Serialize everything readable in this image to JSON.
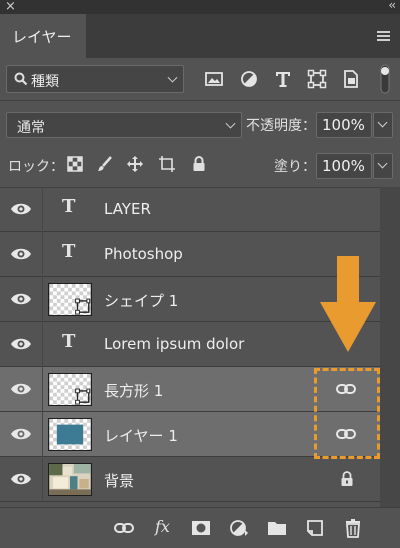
{
  "window": {
    "close_glyph": "×",
    "collapse_glyph": "‹‹"
  },
  "panel": {
    "tab_label": "レイヤー"
  },
  "filter": {
    "kind_label": "種類",
    "icons": [
      "pixel-filter-icon",
      "adjustment-filter-icon",
      "type-filter-icon",
      "shape-filter-icon",
      "smart-object-filter-icon"
    ]
  },
  "blend": {
    "mode": "通常",
    "opacity_label": "不透明度：",
    "opacity_value": "100%"
  },
  "lock": {
    "label": "ロック：",
    "fill_label": "塗り：",
    "fill_value": "100%"
  },
  "layers": [
    {
      "name": "LAYER",
      "kind": "text",
      "visible": true,
      "selected": false
    },
    {
      "name": "Photoshop",
      "kind": "text",
      "visible": true,
      "selected": false
    },
    {
      "name": "シェイプ 1",
      "kind": "shape",
      "visible": true,
      "selected": false
    },
    {
      "name": "Lorem ipsum dolor",
      "kind": "text",
      "visible": true,
      "selected": false
    },
    {
      "name": "長方形 1",
      "kind": "shape",
      "visible": true,
      "selected": true,
      "linked": true
    },
    {
      "name": "レイヤー 1",
      "kind": "pixel",
      "visible": true,
      "selected": true,
      "linked": true
    },
    {
      "name": "背景",
      "kind": "background",
      "visible": true,
      "selected": false,
      "locked": true
    }
  ],
  "bottom_toolbar": [
    "link-layers-icon",
    "fx-icon",
    "add-mask-icon",
    "adjustment-layer-icon",
    "new-group-icon",
    "new-layer-icon",
    "delete-layer-icon"
  ],
  "colors": {
    "panel_bg": "#535353",
    "selected_row": "#6e6e6e",
    "annotation": "#e99b2f"
  }
}
